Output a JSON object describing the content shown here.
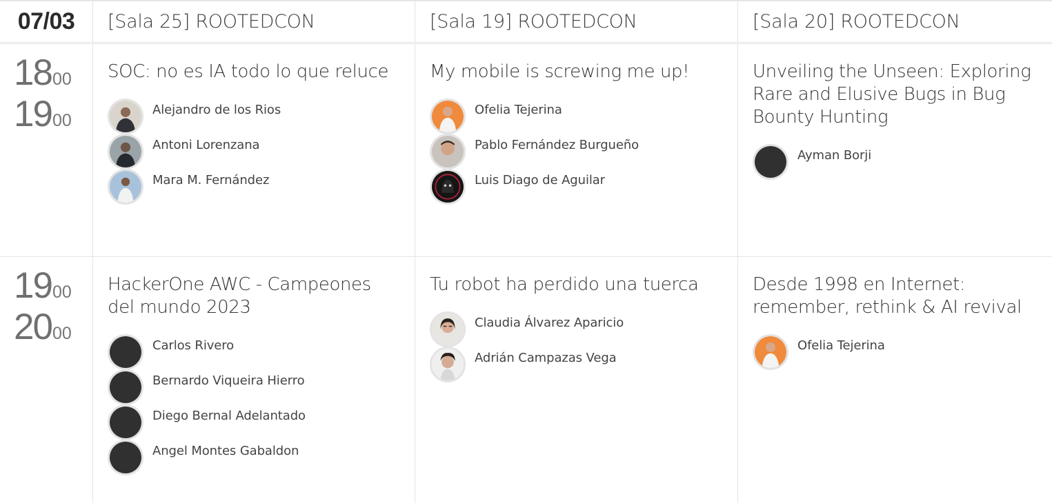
{
  "date": "07/03",
  "rooms": [
    "[Sala 25] ROOTEDCON",
    "[Sala 19] ROOTEDCON",
    "[Sala 20] ROOTEDCON"
  ],
  "slots": [
    {
      "start_hour": "18",
      "start_min": "00",
      "end_hour": "19",
      "end_min": "00",
      "sessions": [
        {
          "title": "SOC: no es IA todo lo que reluce",
          "speakers": [
            "Alejandro de los Rios",
            "Antoni Lorenzana",
            "Mara M. Fernández"
          ]
        },
        {
          "title": "My mobile is screwing me up!",
          "speakers": [
            "Ofelia Tejerina",
            "Pablo Fernández Burgueño",
            "Luis Diago de Aguilar"
          ]
        },
        {
          "title": "Unveiling the Unseen: Exploring Rare and Elusive Bugs in Bug Bounty Hunting",
          "speakers": [
            "Ayman Borji"
          ]
        }
      ]
    },
    {
      "start_hour": "19",
      "start_min": "00",
      "end_hour": "20",
      "end_min": "00",
      "sessions": [
        {
          "title": "HackerOne AWC - Campeones del mundo 2023",
          "speakers": [
            "Carlos Rivero",
            "Bernardo Viqueira Hierro",
            "Diego Bernal Adelantado",
            "Angel Montes Gabaldon"
          ]
        },
        {
          "title": "Tu robot ha perdido una tuerca",
          "speakers": [
            "Claudia Álvarez Aparicio",
            "Adrián Campazas Vega"
          ]
        },
        {
          "title": "Desde 1998 en Internet: remember, rethink & AI revival",
          "speakers": [
            "Ofelia Tejerina"
          ]
        }
      ]
    }
  ]
}
